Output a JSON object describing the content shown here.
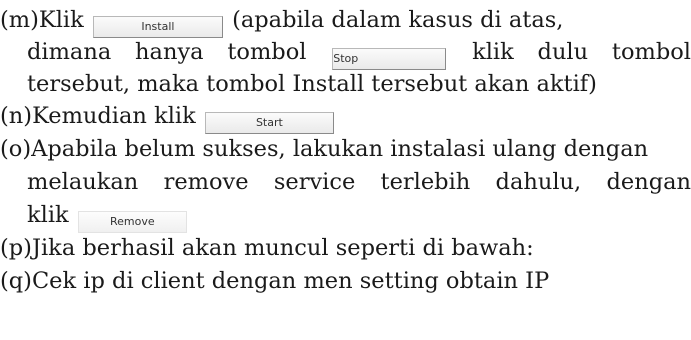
{
  "items": {
    "m": {
      "marker": "(m)",
      "line1_before": "Klik",
      "button_install": "Install",
      "line1_after": "(apabila dalam kasus di atas,",
      "line2_before": "dimana hanya tombol",
      "button_stop": "Stop",
      "line2_after": "klik dulu tombol",
      "line3": "tersebut, maka tombol Install tersebut akan aktif)"
    },
    "n": {
      "marker": "(n)",
      "text_before": "Kemudian klik",
      "button_start": "Start"
    },
    "o": {
      "marker": "(o)",
      "line1": "Apabila belum sukses, lakukan instalasi ulang dengan",
      "line2": "melaukan remove service terlebih dahulu, dengan",
      "line3_before": "klik",
      "button_remove": "Remove"
    },
    "p": {
      "marker": "(p)",
      "text": "Jika berhasil akan muncul seperti di bawah:"
    },
    "q": {
      "marker": "(q)",
      "text": "Cek ip di client dengan men setting obtain IP"
    }
  }
}
